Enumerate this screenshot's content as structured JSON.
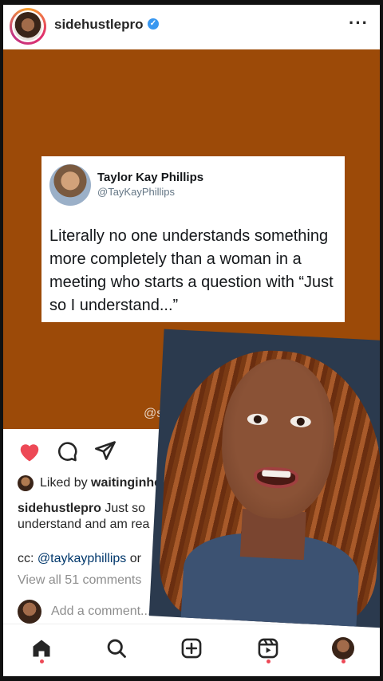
{
  "post": {
    "username": "sidehustlepro",
    "verified": true,
    "more_label": "···"
  },
  "tweet": {
    "name": "Taylor Kay Phillips",
    "handle": "@TayKayPhillips",
    "text": "Literally no one understands something more completely than a woman in a meeting who starts a question with “Just so I understand...”"
  },
  "media": {
    "background_color": "#9c4a08",
    "watermark": "@sidehust"
  },
  "actions": {
    "like_icon": "heart-filled-icon",
    "comment_icon": "comment-icon",
    "share_icon": "share-icon",
    "save_icon": "bookmark-icon",
    "like_color": "#ed4956"
  },
  "likes": {
    "prefix": "Liked by ",
    "user": "waitinginhe"
  },
  "caption": {
    "username": "sidehustlepro",
    "text_line1": " Just so",
    "text_line2": "understand and am rea"
  },
  "cc": {
    "prefix": "cc: ",
    "mention": "@taykayphillips",
    "suffix": " or"
  },
  "comments": {
    "view_all": "View all 51 comments",
    "add_placeholder": "Add a comment..."
  },
  "nav": {
    "items": [
      "home-icon",
      "search-icon",
      "create-icon",
      "reels-icon",
      "profile-avatar"
    ]
  }
}
